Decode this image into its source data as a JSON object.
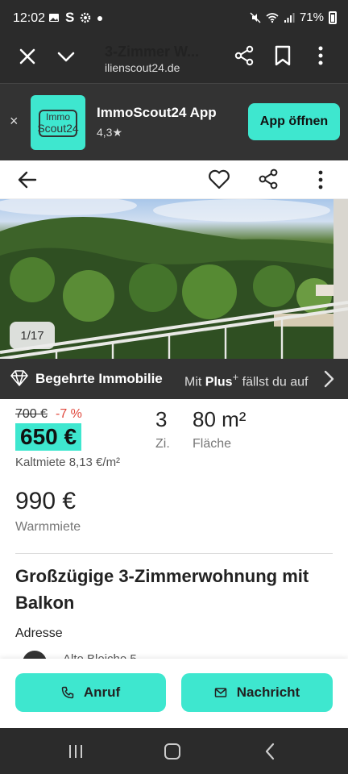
{
  "status_bar": {
    "time": "12:02",
    "carrier_glyph": "S",
    "battery": "71%",
    "icons": [
      "image-icon",
      "settings-icon",
      "dot-icon",
      "mute-icon",
      "wifi-icon",
      "signal-icon",
      "battery-icon"
    ]
  },
  "browser": {
    "title": "3-Zimmer W...",
    "url": "ilienscout24.de",
    "icons": [
      "close-icon",
      "chevron-down-icon",
      "share-icon",
      "bookmark-icon",
      "more-icon"
    ]
  },
  "app_banner": {
    "dismiss": "×",
    "logo_line1": "Immo",
    "logo_line2": "Scout24",
    "app_name": "ImmoScout24 App",
    "rating": "4,3★",
    "open_button": "App öffnen"
  },
  "gallery": {
    "counter": "1/17"
  },
  "plus_banner": {
    "label": "Begehrte Immobilie",
    "upsell_prefix": "Mit",
    "upsell_brand": "Plus",
    "upsell_plus": "+",
    "upsell_suffix": "fällst du auf"
  },
  "listing": {
    "old_price": "700 €",
    "discount": "-7 %",
    "price": "650 €",
    "price_sub": "Kaltmiete 8,13 €/m²",
    "rooms_value": "3",
    "rooms_label": "Zi.",
    "area_value": "80 m²",
    "area_label": "Fläche",
    "warm_value": "990 €",
    "warm_label": "Warmmiete",
    "title": "Großzügige 3-Zimmerwohnung mit Balkon",
    "address_label": "Adresse",
    "address": "Alte Bleiche 5"
  },
  "actions": {
    "call": "Anruf",
    "message": "Nachricht"
  },
  "colors": {
    "accent": "#3ee7cf",
    "dark_bar": "#2b2b2b",
    "discount_red": "#e0483d"
  }
}
